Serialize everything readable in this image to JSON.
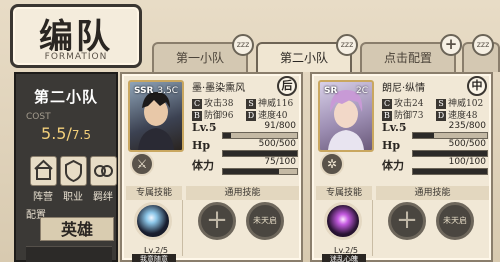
{
  "header": {
    "title": "编队",
    "subtitle": "FORMATION"
  },
  "tabs": [
    {
      "label": "第一小队"
    },
    {
      "label": "第二小队"
    },
    {
      "label": "点击配置"
    }
  ],
  "squad": {
    "name": "第二小队",
    "cost_label": "COST",
    "cost_current": "5.5",
    "cost_max": "7.5",
    "buttons": [
      "阵营",
      "职业",
      "羁绊"
    ],
    "config_label": "配置",
    "config_value": "英雄"
  },
  "heroes": [
    {
      "name": "墨·墨染熏风",
      "rarity": "SSR",
      "level_tag": "3.5C",
      "position": "后",
      "stats": [
        {
          "label": "攻击",
          "value": "38"
        },
        {
          "label": "神威",
          "value": "116"
        },
        {
          "label": "防御",
          "value": "96"
        },
        {
          "label": "速度",
          "value": "40"
        }
      ],
      "level": {
        "label": "Lv.5",
        "text": "91/800",
        "ratio": 0.11
      },
      "hp": {
        "label": "Hp",
        "text": "500/500",
        "ratio": 1.0
      },
      "stamina": {
        "label": "体力",
        "text": "75/100",
        "ratio": 0.75
      },
      "skill_headers": [
        "专属技能",
        "通用技能"
      ],
      "exclusive_skill": {
        "level": "Lv.2/5",
        "name": "我意随意"
      },
      "locked_label": "未天启"
    },
    {
      "name": "朗尼·纵情",
      "rarity": "SR",
      "level_tag": "2C",
      "position": "中",
      "stats": [
        {
          "label": "攻击",
          "value": "24"
        },
        {
          "label": "神威",
          "value": "102"
        },
        {
          "label": "防御",
          "value": "73"
        },
        {
          "label": "速度",
          "value": "48"
        }
      ],
      "level": {
        "label": "Lv.5",
        "text": "235/800",
        "ratio": 0.29
      },
      "hp": {
        "label": "Hp",
        "text": "500/500",
        "ratio": 1.0
      },
      "stamina": {
        "label": "体力",
        "text": "100/100",
        "ratio": 1.0
      },
      "skill_headers": [
        "专属技能",
        "通用技能"
      ],
      "exclusive_skill": {
        "level": "Lv.2/5",
        "name": "迷乱心魄"
      },
      "locked_label": "未天启"
    }
  ]
}
